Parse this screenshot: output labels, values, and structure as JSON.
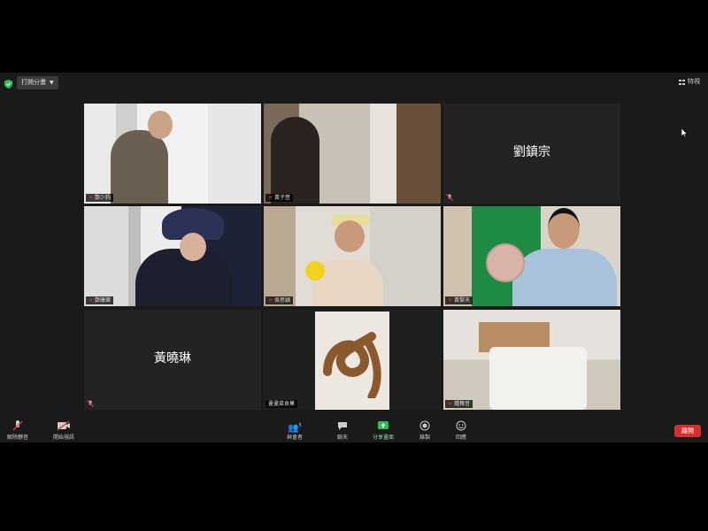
{
  "top_bar": {
    "share_label": "打開分畫",
    "view_label": "特視"
  },
  "tiles": [
    {
      "name": "鄭少鈞"
    },
    {
      "name": "黃子萱"
    },
    {
      "name": "",
      "display_name": "劉鎮宗"
    },
    {
      "name": "鄭康樂"
    },
    {
      "name": "吳思穎"
    },
    {
      "name": "黃黎天"
    },
    {
      "name": "",
      "display_name": "黃曉琳"
    },
    {
      "name": "畫畫菜食菓"
    },
    {
      "name": "鍾舞音"
    }
  ],
  "toolbar": {
    "mic_label": "解除靜音",
    "video_label": "開始視訊",
    "participants_label": "與會者",
    "participants_count": "5",
    "chat_label": "聊天",
    "share_label": "分享畫面",
    "record_label": "錄製",
    "reactions_label": "回應",
    "leave_label": "離開"
  },
  "colors": {
    "active_speaker": "#c7d24a",
    "share_green": "#2dbd5a",
    "leave_red": "#d32f2f"
  }
}
